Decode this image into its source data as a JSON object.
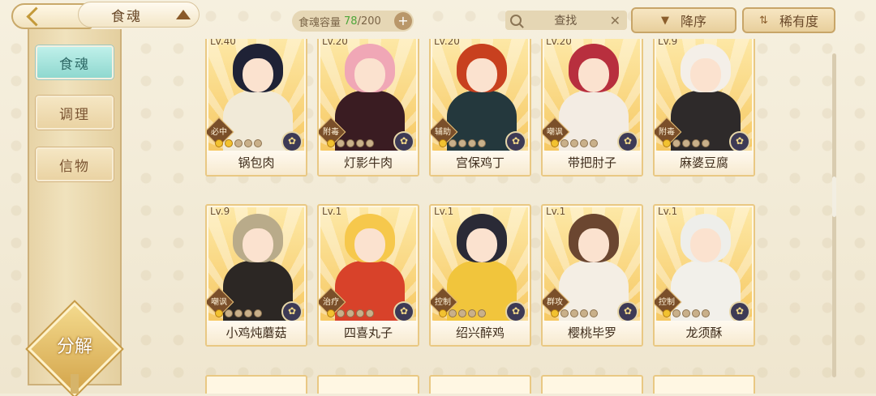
{
  "header": {
    "title": "食魂",
    "capacity_label": "食魂容量",
    "capacity_current": "78",
    "capacity_total": "/200",
    "search_label": "查找",
    "sort_order_label": "降序",
    "sort_rarity_label": "稀有度"
  },
  "sidebar": {
    "items": [
      {
        "label": "食魂",
        "active": true
      },
      {
        "label": "调理",
        "active": false
      },
      {
        "label": "信物",
        "active": false
      }
    ],
    "decompose_label": "分解"
  },
  "cards": [
    {
      "level": "Lv.40",
      "name": "锅包肉",
      "tag": "必中",
      "stars": 2,
      "hair": "#1f2236",
      "outfit": "#f1ead8"
    },
    {
      "level": "Lv.20",
      "name": "灯影牛肉",
      "tag": "附毒",
      "stars": 1,
      "hair": "#f0a7b6",
      "outfit": "#3a1c22"
    },
    {
      "level": "Lv.20",
      "name": "宫保鸡丁",
      "tag": "辅助",
      "stars": 1,
      "hair": "#c8401f",
      "outfit": "#24383d"
    },
    {
      "level": "Lv.20",
      "name": "带把肘子",
      "tag": "嘲讽",
      "stars": 1,
      "hair": "#b82f3e",
      "outfit": "#f3ece3"
    },
    {
      "level": "Lv.9",
      "name": "麻婆豆腐",
      "tag": "附毒",
      "stars": 1,
      "hair": "#f4efe8",
      "outfit": "#2e2a2a"
    },
    {
      "level": "Lv.9",
      "name": "小鸡炖蘑菇",
      "tag": "嘲讽",
      "stars": 1,
      "hair": "#b9ab8a",
      "outfit": "#2c2724"
    },
    {
      "level": "Lv.1",
      "name": "四喜丸子",
      "tag": "治疗",
      "stars": 1,
      "hair": "#f6c84c",
      "outfit": "#d8422a"
    },
    {
      "level": "Lv.1",
      "name": "绍兴醉鸡",
      "tag": "控制",
      "stars": 1,
      "hair": "#2a2a36",
      "outfit": "#f1c53c"
    },
    {
      "level": "Lv.1",
      "name": "樱桃毕罗",
      "tag": "群攻",
      "stars": 1,
      "hair": "#6b4630",
      "outfit": "#f4eee4"
    },
    {
      "level": "Lv.1",
      "name": "龙须酥",
      "tag": "控制",
      "stars": 1,
      "hair": "#eeeeea",
      "outfit": "#f2f0ea"
    }
  ]
}
